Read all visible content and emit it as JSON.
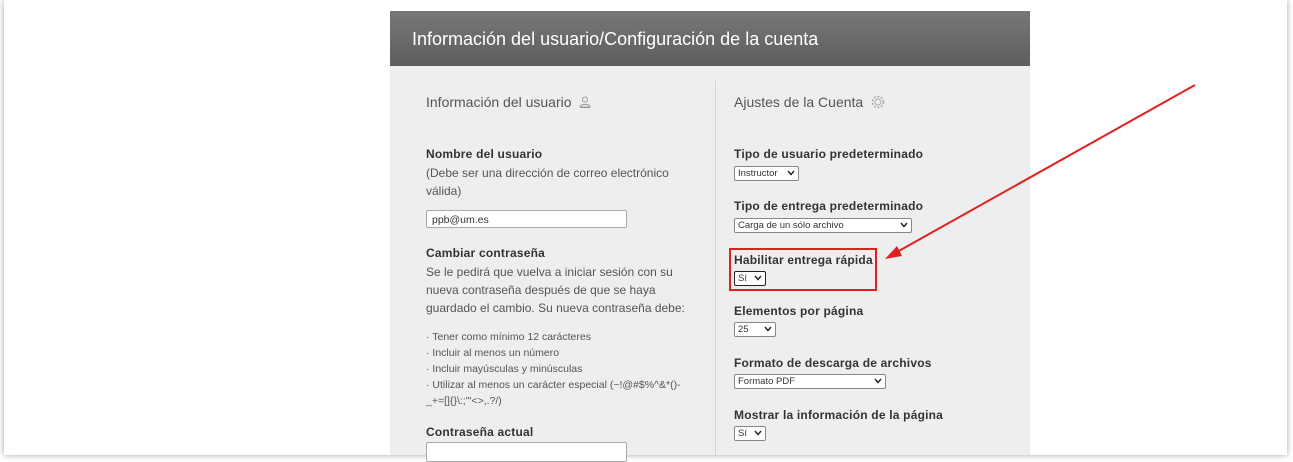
{
  "header": {
    "title": "Información del usuario/Configuración de la cuenta"
  },
  "user_info": {
    "title": "Información del usuario",
    "title_icon": "user-icon",
    "username_label": "Nombre del usuario",
    "username_hint": "(Debe ser una dirección de correo electrónico válida)",
    "email_value": "ppb@um.es",
    "change_password_label": "Cambiar contraseña",
    "change_password_text": "Se le pedirá que vuelva a iniciar sesión con su nueva contraseña después de que se haya guardado el cambio. Su nueva contraseña debe:",
    "rules": [
      "Tener como mínimo 12 carácteres",
      "Incluir al menos un número",
      "Incluir mayúsculas y minúsculas",
      "Utilizar al menos un carácter especial (~!@#$%^&*()-_+=[]{}\\:;\"'<>,.?/)"
    ],
    "current_password_label": "Contraseña actual",
    "current_password_value": ""
  },
  "account_settings": {
    "title": "Ajustes de la Cuenta",
    "title_icon": "gear-icon",
    "default_user_type_label": "Tipo de usuario predeterminado",
    "default_user_type_value": "Instructor",
    "default_submission_type_label": "Tipo de entrega predeterminado",
    "default_submission_type_value": "Carga de un sólo archivo",
    "quick_submit_label": "Habilitar entrega rápida",
    "quick_submit_value": "Sí",
    "items_per_page_label": "Elementos por página",
    "items_per_page_value": "25",
    "download_format_label": "Formato de descarga de archivos",
    "download_format_value": "Formato PDF",
    "show_page_info_label": "Mostrar la información de la página",
    "show_page_info_value": "Sí"
  },
  "annotation": {
    "color": "#e02020"
  }
}
